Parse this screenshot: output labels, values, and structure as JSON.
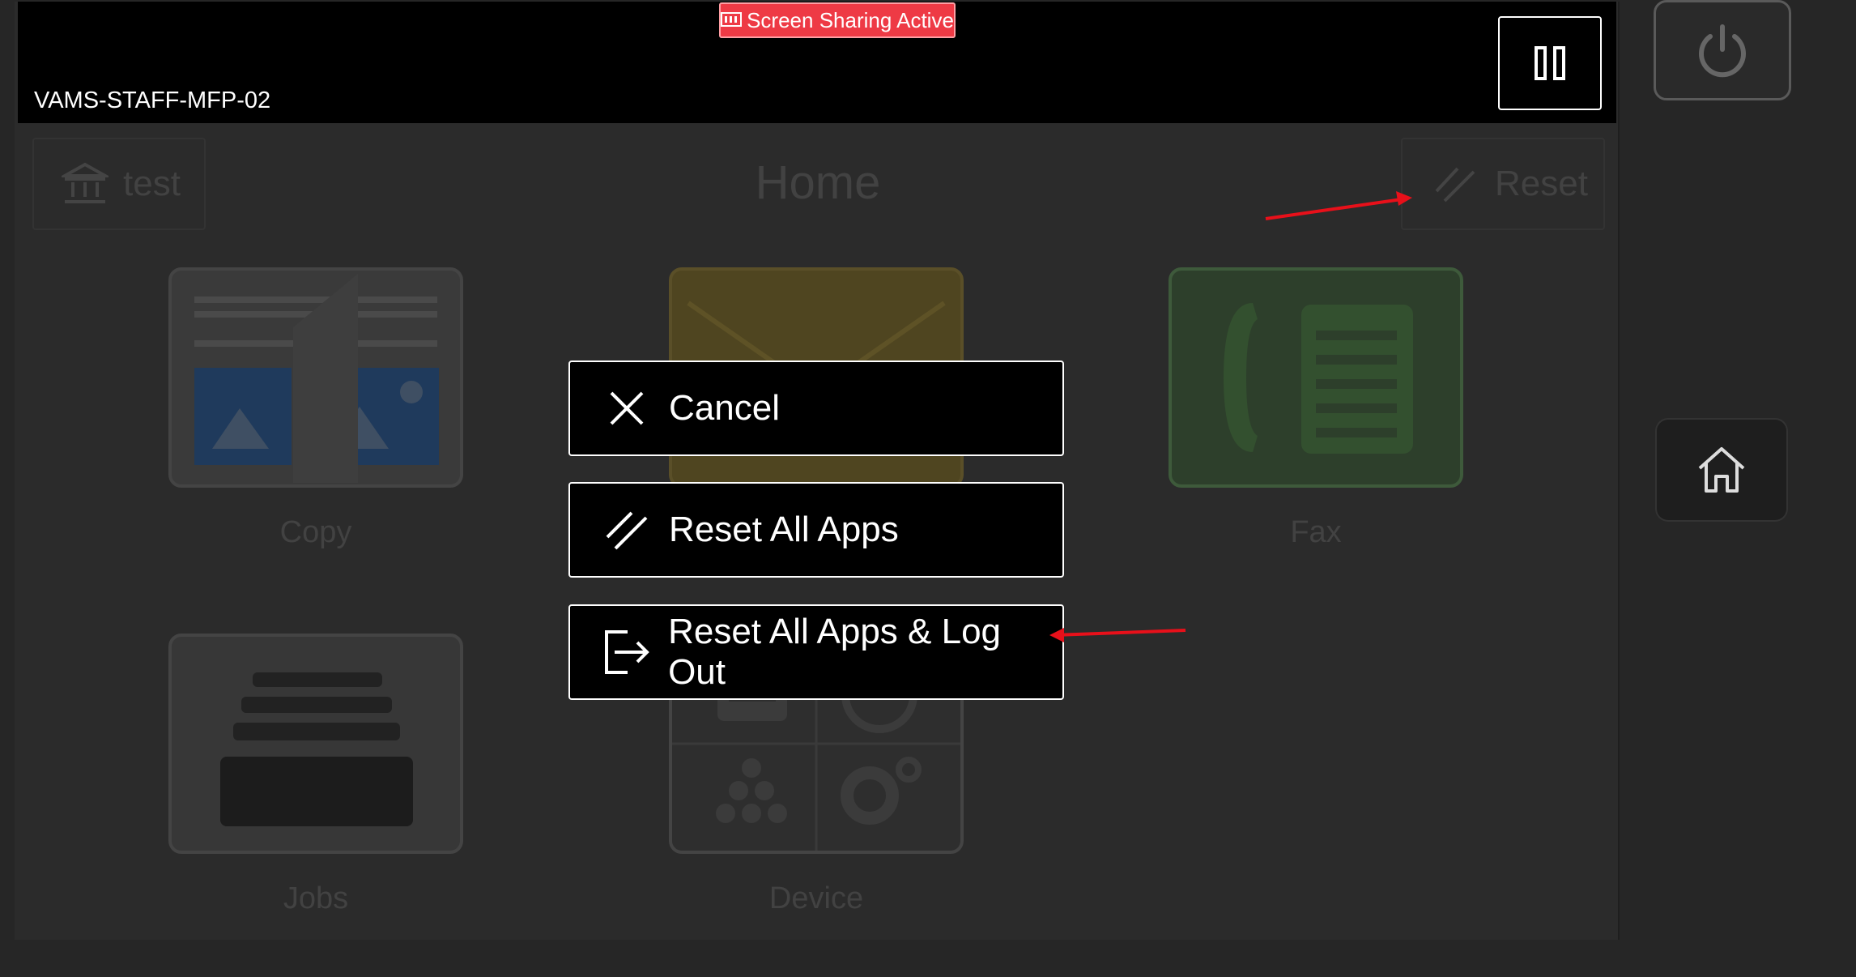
{
  "topbar": {
    "banner_text": "Screen Sharing Active",
    "device_name": "VAMS-STAFF-MFP-02",
    "pause_icon": "pause-icon"
  },
  "home": {
    "title": "Home",
    "account_chip": {
      "label": "test",
      "icon": "bank-icon"
    },
    "reset_chip": {
      "label": "Reset",
      "icon": "reset-slash-icon"
    },
    "tiles": [
      {
        "label": "Copy",
        "icon": "copy-icon"
      },
      {
        "label": "",
        "icon": "email-icon"
      },
      {
        "label": "Fax",
        "icon": "fax-icon"
      },
      {
        "label": "Jobs",
        "icon": "jobs-tray-icon"
      },
      {
        "label": "Device",
        "icon": "device-icon"
      }
    ]
  },
  "menu": {
    "cancel": "Cancel",
    "reset_all": "Reset All Apps",
    "reset_logout": "Reset All Apps & Log Out"
  },
  "hardware": {
    "power_icon": "power-icon",
    "home_icon": "home-icon"
  },
  "colors": {
    "banner": "#ee3a45",
    "annotation_arrow": "#e8101a"
  }
}
